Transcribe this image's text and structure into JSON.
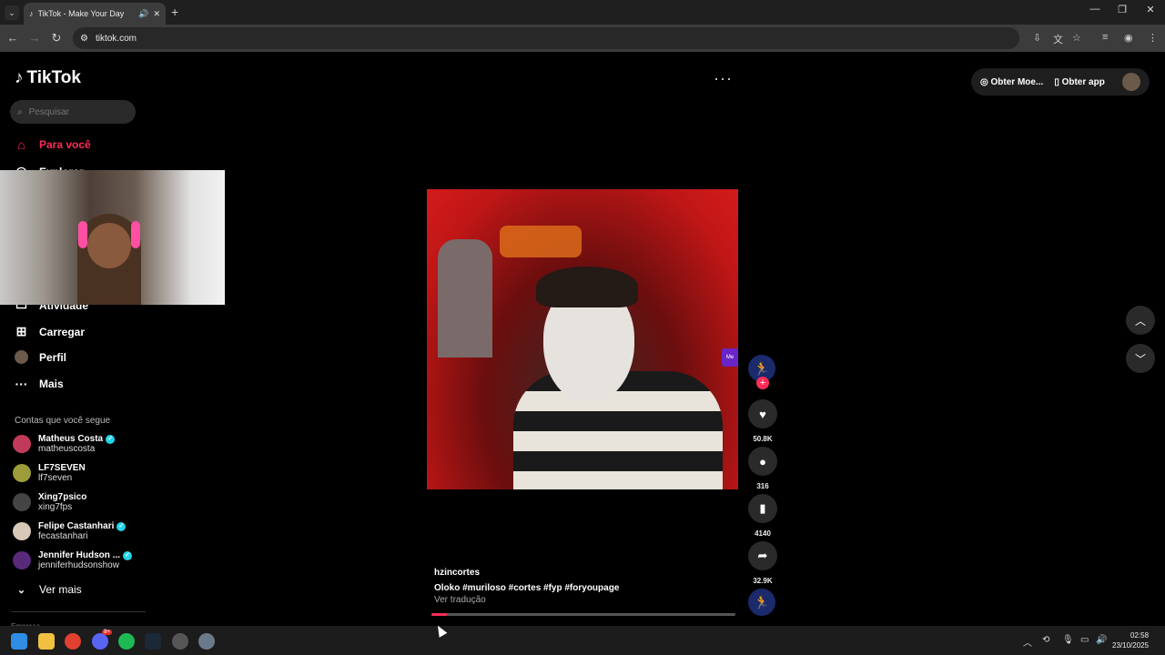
{
  "browser": {
    "tab_title": "TikTok - Make Your Day",
    "url": "tiktok.com"
  },
  "sidebar": {
    "logo": "TikTok",
    "search_placeholder": "Pesquisar",
    "nav": [
      {
        "label": "Para você",
        "icon": "home-icon",
        "active": true
      },
      {
        "label": "Explorar",
        "icon": "compass-icon"
      },
      {
        "label": "Atividade",
        "icon": "message-icon"
      },
      {
        "label": "Carregar",
        "icon": "upload-icon"
      },
      {
        "label": "Perfil",
        "icon": "avatar"
      },
      {
        "label": "Mais",
        "icon": "more-icon"
      }
    ],
    "following_heading": "Contas que você segue",
    "accounts": [
      {
        "name": "Matheus Costa",
        "username": "matheuscosta",
        "verified": true
      },
      {
        "name": "LF7SEVEN",
        "username": "lf7seven",
        "verified": false
      },
      {
        "name": "Xing7psico",
        "username": "xing7fps",
        "verified": false
      },
      {
        "name": "Felipe Castanhari",
        "username": "fecastanhari",
        "verified": true
      },
      {
        "name": "Jennifer Hudson ...",
        "username": "jenniferhudsonshow",
        "verified": true
      }
    ],
    "see_more": "Ver mais",
    "footer": "Empresa"
  },
  "header": {
    "more_label": "···",
    "coins_label": "Obter Moe...",
    "app_label": "Obter app"
  },
  "video": {
    "author": "hzincortes",
    "caption": "Oloko #muriloso #cortes #fyp #foryoupage",
    "translate": "Ver tradução",
    "progress": 0.05,
    "side_badge": "Me"
  },
  "actions": {
    "likes": "50.8K",
    "comments": "316",
    "saves": "4140",
    "shares": "32.9K"
  },
  "taskbar": {
    "time": "02:58",
    "date": "23/10/2025",
    "discord_badge": "9+"
  },
  "colors": {
    "accent": "#fe2c55",
    "verified": "#20d5ec"
  }
}
